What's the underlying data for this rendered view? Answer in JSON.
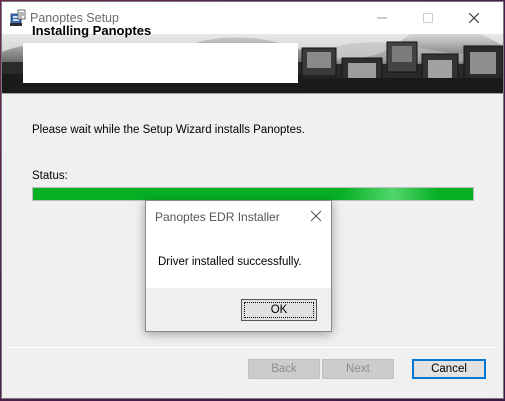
{
  "window": {
    "title": "Panoptes Setup",
    "icon": "installer-icon"
  },
  "banner": {
    "heading": "Installing Panoptes"
  },
  "content": {
    "message": "Please wait while the Setup Wizard installs Panoptes.",
    "status_label": "Status:",
    "progress_fraction": 1.0,
    "progress_color": "#06b025"
  },
  "buttons": {
    "back": "Back",
    "next": "Next",
    "cancel": "Cancel"
  },
  "dialog": {
    "title": "Panoptes EDR Installer",
    "message": "Driver installed successfully.",
    "ok": "OK"
  },
  "colors": {
    "accent": "#0078d7"
  }
}
